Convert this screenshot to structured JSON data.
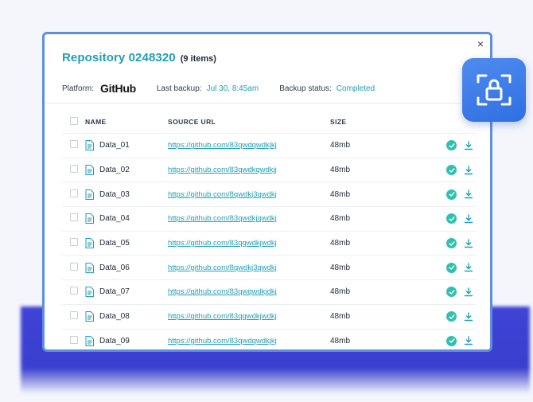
{
  "dialog": {
    "title": "Repository 0248320",
    "item_count": "(9 items)",
    "close_label": "×"
  },
  "meta": {
    "platform_label": "Platform:",
    "platform_value": "GitHub",
    "last_backup_label": "Last backup:",
    "last_backup_value": "Jul 30, 8:45am",
    "status_label": "Backup status:",
    "status_value": "Completed"
  },
  "table": {
    "headers": {
      "name": "NAME",
      "url": "SOURCE URL",
      "size": "SIZE"
    },
    "rows": [
      {
        "name": "Data_01",
        "url": "https://github.com/83qwdqwdkjkj",
        "size": "48mb"
      },
      {
        "name": "Data_02",
        "url": "https://github.com/83qwdkqwdkjj",
        "size": "48mb"
      },
      {
        "name": "Data_03",
        "url": "https://github.com/8qwdkj3qwdkj",
        "size": "48mb"
      },
      {
        "name": "Data_04",
        "url": "https://github.com/83qwdkjqwdkj",
        "size": "48mb"
      },
      {
        "name": "Data_05",
        "url": "https://github.com/83qqwdkjwdkj",
        "size": "48mb"
      },
      {
        "name": "Data_06",
        "url": "https://github.com/8qwdkj3qwdkj",
        "size": "48mb"
      },
      {
        "name": "Data_07",
        "url": "https://github.com/83qwqwdkjdkj",
        "size": "48mb"
      },
      {
        "name": "Data_08",
        "url": "https://github.com/83qqwdkjwdkj",
        "size": "48mb"
      },
      {
        "name": "Data_09",
        "url": "https://github.com/83qwdqwdkjkj",
        "size": "48mb"
      }
    ]
  },
  "colors": {
    "accent": "#1f9fb4",
    "check": "#2fc1b0",
    "border": "#5d8fe0",
    "badge": "#3a7be8"
  },
  "icons": {
    "file": "file-icon",
    "check": "check-circle-icon",
    "download": "download-icon",
    "lock": "lock-scan-icon"
  }
}
